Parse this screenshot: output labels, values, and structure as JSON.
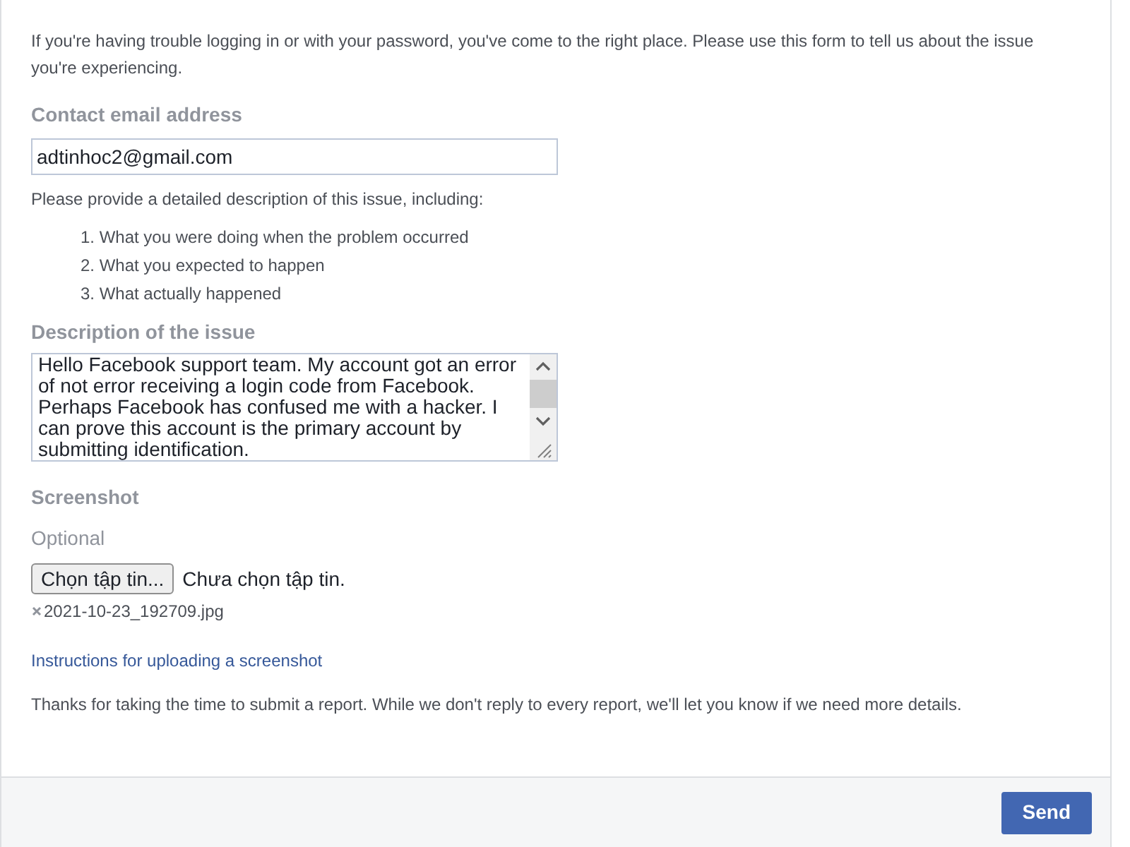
{
  "intro": "If you're having trouble logging in or with your password, you've come to the right place. Please use this form to tell us about the issue you're experiencing.",
  "email": {
    "label": "Contact email address",
    "value": "adtinhoc2@gmail.com"
  },
  "instructions": "Please provide a detailed description of this issue, including:",
  "steps": [
    "1. What you were doing when the problem occurred",
    "2. What you expected to happen",
    "3. What actually happened"
  ],
  "description": {
    "label": "Description of the issue",
    "value": "Hello Facebook support team. My account got an error of not error receiving a login code from Facebook. Perhaps Facebook has confused me with a hacker. I can prove this account is the primary account by submitting identification."
  },
  "screenshot": {
    "label": "Screenshot",
    "hint": "Optional",
    "choose_button": "Chọn tập tin...",
    "status": "Chưa chọn tập tin.",
    "attachment": "2021-10-23_192709.jpg"
  },
  "help_link": "Instructions for uploading a screenshot",
  "thanks": "Thanks for taking the time to submit a report. While we don't reply to every report, we'll let you know if we need more details.",
  "buttons": [
    "Send"
  ]
}
